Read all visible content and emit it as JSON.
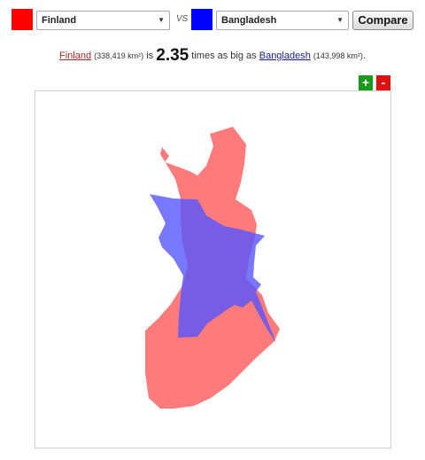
{
  "colors": {
    "country1": "#ff0000",
    "country2": "#0000ff",
    "shape1_fill": "#ff7b7b",
    "shape2_fill": "#5555ff",
    "zoom_in": "#1a9a1a",
    "zoom_out": "#e01010"
  },
  "selectors": {
    "country1": {
      "selected": "Finland"
    },
    "vs_label": "VS",
    "country2": {
      "selected": "Bangladesh"
    },
    "compare_label": "Compare"
  },
  "summary": {
    "country1_name": "Finland",
    "country1_area": "(338,419 km²)",
    "is_text": "is",
    "ratio": "2.35",
    "middle_text": "times as big as",
    "country2_name": "Bangladesh",
    "country2_area": "(143,998 km²)",
    "end_text": "."
  },
  "zoom": {
    "in_label": "+",
    "out_label": "-"
  },
  "icons": {
    "dropdown": "caret-down-icon"
  }
}
